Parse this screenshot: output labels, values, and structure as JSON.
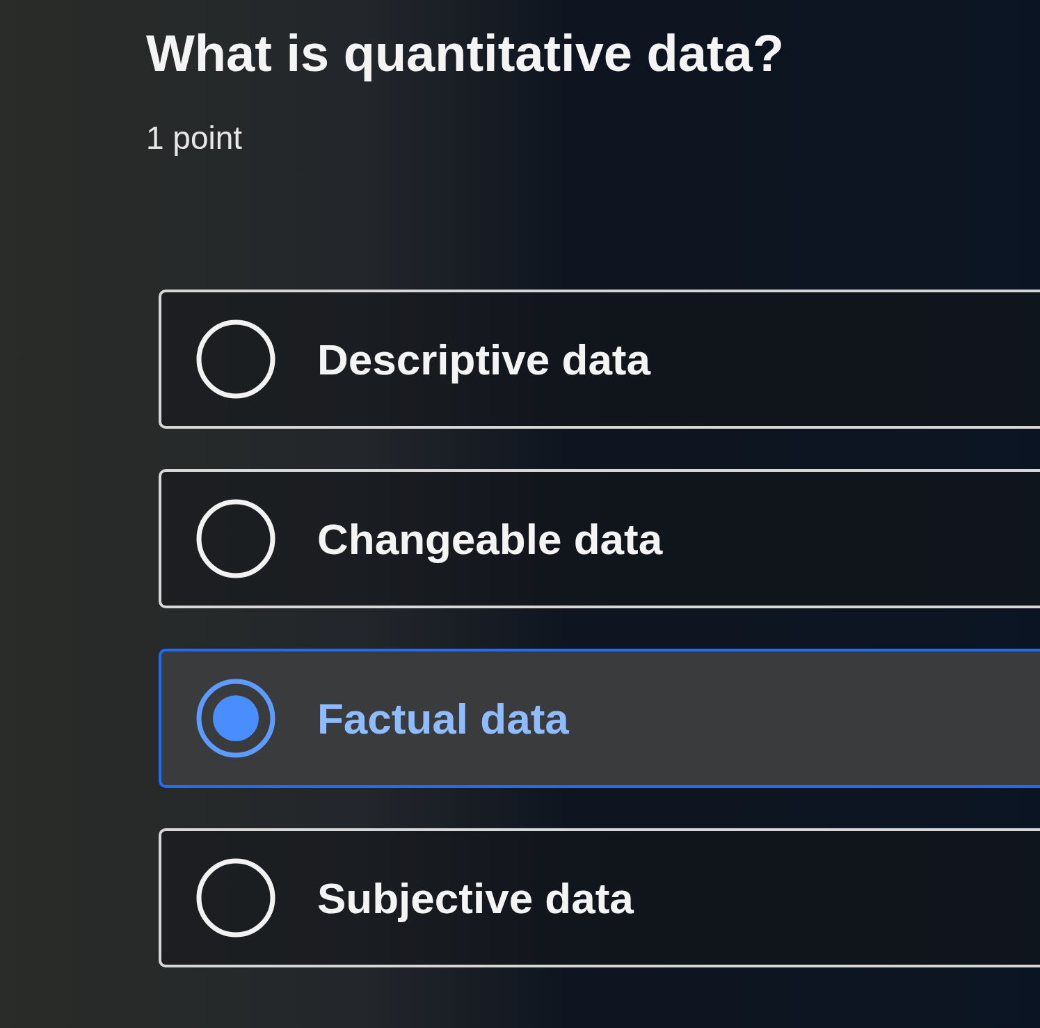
{
  "question": {
    "title": "What is quantitative data?",
    "points": "1 point"
  },
  "options": [
    {
      "label": "Descriptive data",
      "selected": false
    },
    {
      "label": "Changeable data",
      "selected": false
    },
    {
      "label": "Factual data",
      "selected": true
    },
    {
      "label": "Subjective data",
      "selected": false
    }
  ]
}
